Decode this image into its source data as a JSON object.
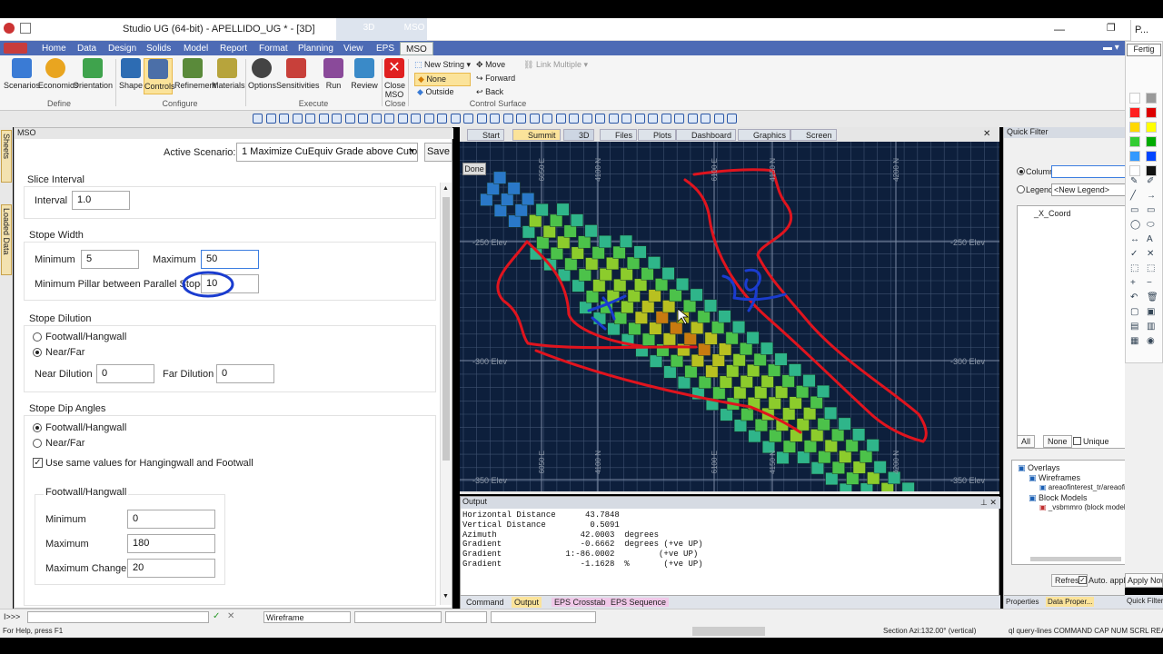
{
  "window": {
    "title": "Studio UG (64-bit) - APELLIDO_UG * - [3D]",
    "context_tabs": [
      "3D",
      "MSO"
    ],
    "side_title": "P..."
  },
  "menu_tabs": [
    "Home",
    "Data",
    "Design",
    "Solids",
    "Model",
    "Report",
    "Format",
    "Planning",
    "View",
    "EPS",
    "MSO"
  ],
  "ribbon": {
    "buttons": [
      "Scenarios",
      "Economics",
      "Orientation",
      "Shape",
      "Controls",
      "Refinement",
      "Materials",
      "Options",
      "Sensitivities",
      "Run",
      "Review",
      "Close MSO"
    ],
    "groups": [
      "Define",
      "Configure",
      "Execute",
      "Close",
      "Control Surface"
    ],
    "control_surface": {
      "new_string": "New String",
      "none": "None",
      "outside": "Outside",
      "move": "Move",
      "forward": "Forward",
      "back": "Back",
      "link_multiple": "Link Multiple"
    }
  },
  "left_tabs": [
    "Sheets",
    "Loaded Data"
  ],
  "mso": {
    "panel_title": "MSO",
    "active_scenario_label": "Active Scenario:",
    "active_scenario_value": "1 Maximize CuEquiv Grade above Cutoff",
    "save": "Save",
    "slice": {
      "title": "Slice Interval",
      "interval_label": "Interval",
      "interval": "1.0"
    },
    "stope_width": {
      "title": "Stope Width",
      "min_label": "Minimum",
      "min": "5",
      "max_label": "Maximum",
      "max": "50",
      "pillar_label": "Minimum Pillar between Parallel Stopes",
      "pillar": "10"
    },
    "dilution": {
      "title": "Stope Dilution",
      "opt1": "Footwall/Hangwall",
      "opt2": "Near/Far",
      "selected": "Near/Far",
      "near_label": "Near Dilution",
      "near": "0",
      "far_label": "Far Dilution",
      "far": "0"
    },
    "dip": {
      "title": "Stope Dip Angles",
      "opt1": "Footwall/Hangwall",
      "opt2": "Near/Far",
      "selected": "Footwall/Hangwall",
      "same_values": "Use same values for Hangingwall and Footwall",
      "same_checked": true,
      "sub_title": "Footwall/Hangwall",
      "min_label": "Minimum",
      "min": "0",
      "max_label": "Maximum",
      "max": "180",
      "maxchg_label": "Maximum Change",
      "maxchg": "20"
    }
  },
  "view_tabs": [
    "Start",
    "Summit",
    "3D",
    "Files",
    "Plots",
    "Dashboard",
    "Graphics",
    "Screen"
  ],
  "viewport": {
    "done": "Done",
    "elev_labels": [
      "-250 Elev",
      "-300 Elev",
      "-350 Elev"
    ],
    "east_labels": [
      "6050 E",
      "4100 N",
      "6100 E",
      "4150 N",
      "4200 N"
    ],
    "annotations": [
      "2",
      "19"
    ]
  },
  "output": {
    "title": "Output",
    "lines": [
      "Horizontal Distance      43.7848",
      "Vertical Distance         0.5091",
      "Azimuth                 42.0003  degrees",
      "Gradient                -0.6662  degrees (+ve UP)",
      "Gradient             1:-86.0002         (+ve UP)",
      "Gradient                -1.1628  %       (+ve UP)"
    ],
    "tabs": [
      "Command",
      "Output",
      "EPS Crosstab",
      "EPS Sequence"
    ]
  },
  "quick_filter": {
    "title": "Quick Filter",
    "column_label": "Column:",
    "legend_label": "Legend:",
    "legend_value": "<New Legend>",
    "column_item": "_X_Coord",
    "all": "All",
    "none": "None",
    "unique": "Unique",
    "tree": [
      "Overlays",
      "Wireframes",
      "areaofinterest_tr/areaofinterest_p",
      "Block Models",
      "_vsbmmro (block model)"
    ],
    "refresh": "Refresh",
    "auto_apply": "Auto. apply",
    "apply_now": "Apply Now",
    "tabs": [
      "Properties",
      "Data Proper...",
      "Quick Filter"
    ]
  },
  "side_palette": {
    "button": "Fertig"
  },
  "statusbar": {
    "prompt": "I>>>",
    "wireframe": "Wireframe"
  },
  "bottombar": {
    "help": "For Help, press F1",
    "section": "Section Azi:132.00° (vertical)",
    "right": "ql query-lines  COMMAND  CAP  NUM  SCRL  READ"
  },
  "colors": {
    "accent": "#4d6bb5",
    "viewport_bg": "#0d1f3c",
    "annotation": "#e0141e",
    "annotation_blue": "#1a3ccf"
  }
}
